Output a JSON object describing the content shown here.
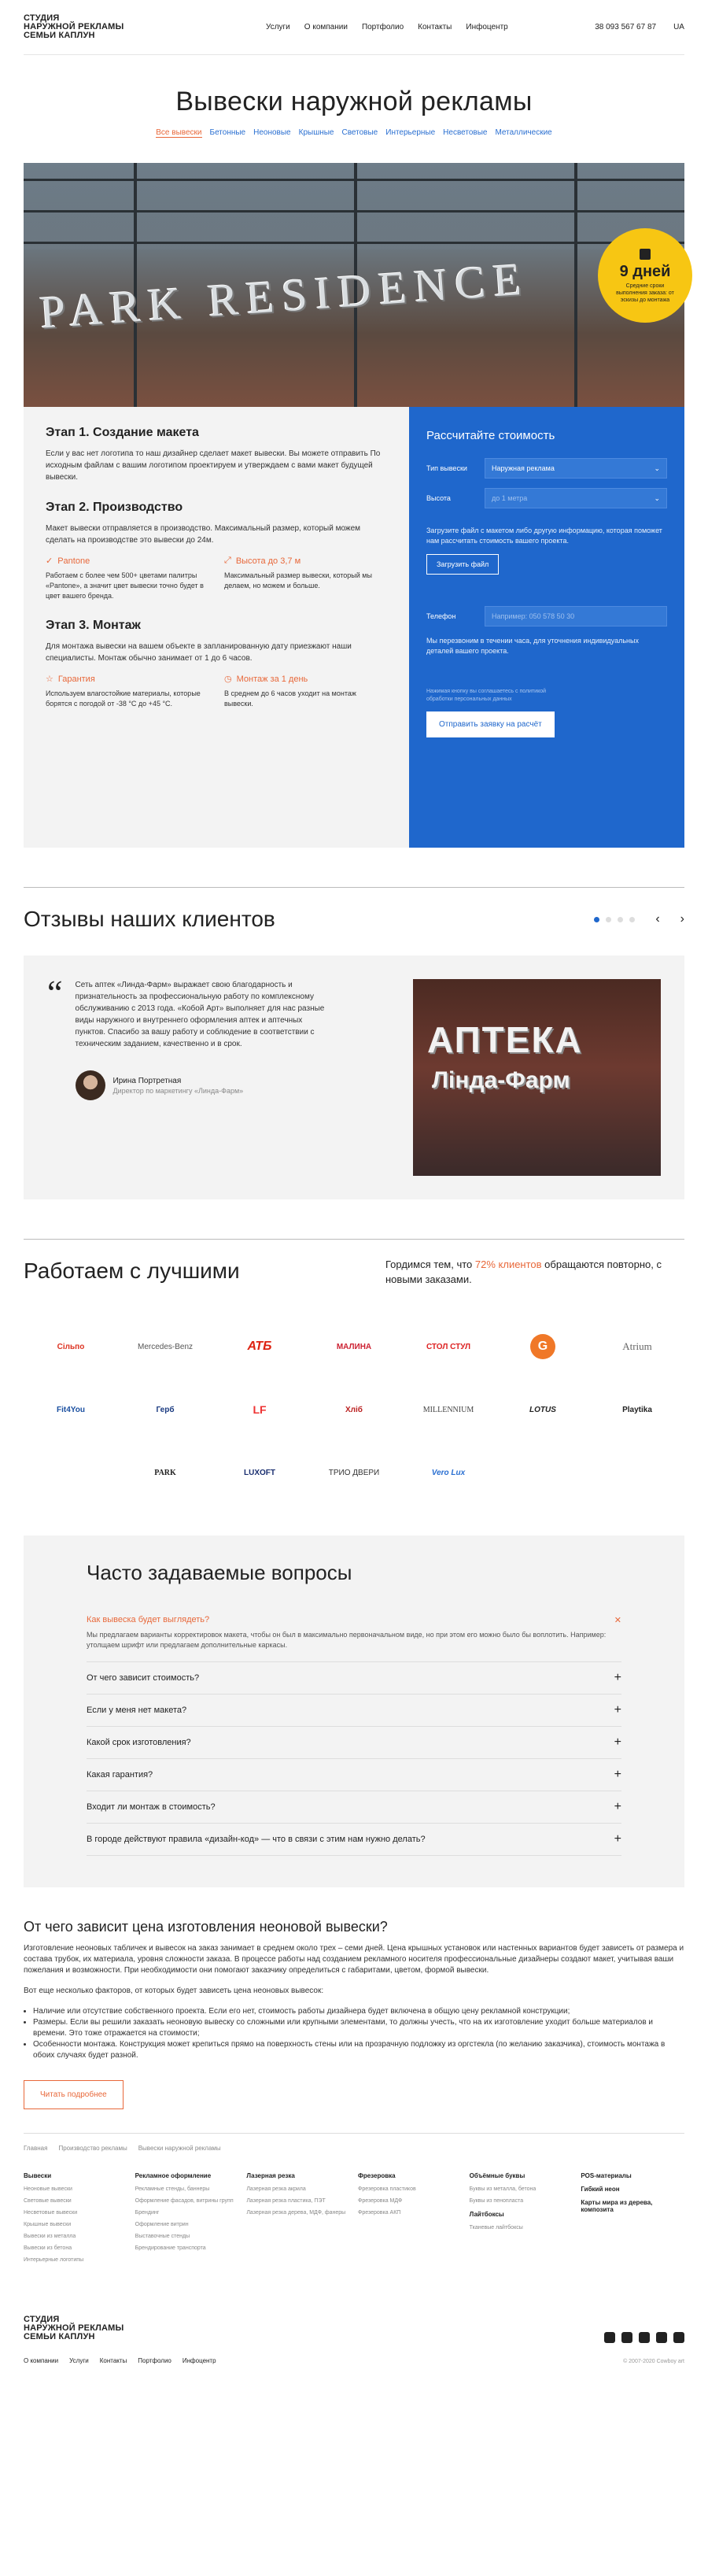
{
  "header": {
    "logo_lines": [
      "СТУДИЯ",
      "НАРУЖНОЙ РЕКЛАМЫ",
      "СЕМЬИ КАПЛУН"
    ],
    "nav": [
      "Услуги",
      "О компании",
      "Портфолио",
      "Контакты",
      "Инфоцентр"
    ],
    "phone": "38 093 567 67 87",
    "lang": "UA"
  },
  "page": {
    "title": "Вывески наружной рекламы",
    "tabs": [
      "Все вывески",
      "Бетонные",
      "Неоновые",
      "Крышные",
      "Световые",
      "Интерьерные",
      "Несветовые",
      "Металлические"
    ]
  },
  "hero": {
    "sign_text": "PARK RESIDENCE",
    "badge": {
      "days": "9 дней",
      "text": "Средние сроки выполнения заказа: от эскизы до монтажа"
    }
  },
  "stages": [
    {
      "title": "Этап 1. Создание макета",
      "text": "Если у вас нет логотипа то наш дизайнер сделает макет вывески. Вы можете отправить По исходным файлам с вашим логотипом проектируем и утверждаем с вами макет будущей вывески."
    },
    {
      "title": "Этап 2. Производство",
      "text": "Макет вывески отправляется в производство. Максимальный размер, который можем сделать на производстве это вывески до 24м.",
      "features": [
        {
          "title": "Pantone",
          "text": "Работаем с более чем 500+ цветами палитры «Pantone», а значит цвет вывески точно будет в цвет вашего бренда."
        },
        {
          "title": "Высота до 3,7 м",
          "text": "Максимальный размер вывески, который мы делаем, но можем и больше."
        }
      ]
    },
    {
      "title": "Этап 3. Монтаж",
      "text": "Для монтажа вывески на вашем объекте в запланированную дату приезжают наши специалисты. Монтаж обычно занимает от 1 до 6 часов.",
      "features": [
        {
          "title": "Гарантия",
          "text": "Используем влагостойкие материалы, которые борятся с погодой от -38 °С до +45 °С."
        },
        {
          "title": "Монтаж за 1 день",
          "text": "В среднем до 6 часов уходит на монтаж вывески."
        }
      ]
    }
  ],
  "calc": {
    "title": "Рассчитайте стоимость",
    "type_label": "Тип вывески",
    "type_value": "Наружная реклама",
    "height_label": "Высота",
    "height_ph": "до 1 метра",
    "upload_text": "Загрузите файл с макетом либо другую информацию, которая поможет нам рассчитать стоимость вашего проекта.",
    "upload_btn": "Загрузить файл",
    "phone_label": "Телефон",
    "phone_ph": "Например: 050 578 50 30",
    "callback_text": "Мы перезвоним в течении часа, для уточнения индивидуальных деталей вашего проекта.",
    "consent": "Нажимая кнопку вы соглашаетесь с политикой обработки персональных данных",
    "submit": "Отправить заявку на расчёт"
  },
  "reviews": {
    "title": "Отзывы наших клиентов",
    "text": "Сеть аптек «Линда-Фарм» выражает свою благодарность и признательность за профессиональную работу по комплексному обслуживанию с 2013 года. «Кобой Арт» выполняет для нас разные виды наружного и внутреннего оформления аптек и аптечных пунктов. Спасибо за вашу работу и соблюдение в соответствии с техническим заданием, качественно и в срок.",
    "author": "Ирина Портретная",
    "role": "Директор по маркетингу «Линда-Фарм»",
    "photo_l1": "АПТЕКА",
    "photo_l2": "Лінда-Фарм"
  },
  "partners": {
    "title": "Работаем с лучшими",
    "text_a": "Гордимся тем, что ",
    "highlight": "72% клиентов",
    "text_b": " обращаются повторно, с новыми заказами.",
    "logos": [
      "Сільпо",
      "Mercedes-Benz",
      "АТБ",
      "МАЛИНА",
      "СТОЛ СТУЛ",
      "G",
      "Atrium",
      "Fit4You",
      "Герб",
      "LF",
      "Хліб",
      "MILLENNIUM",
      "LOTUS",
      "Playtika",
      "PARK",
      "LUXOFT",
      "ТРИО ДВЕРИ",
      "Vero Lux"
    ]
  },
  "faq": {
    "title": "Часто задаваемые вопросы",
    "items": [
      {
        "q": "Как вывеска будет выглядеть?",
        "a": "Мы предлагаем варианты корректировок макета, чтобы он был в максимально первоначальном виде, но при этом его можно было бы воплотить. Например: утолщаем шрифт или предлагаем дополнительные каркасы."
      },
      {
        "q": "От чего зависит стоимость?"
      },
      {
        "q": "Если у меня нет макета?"
      },
      {
        "q": "Какой срок изготовления?"
      },
      {
        "q": "Какая гарантия?"
      },
      {
        "q": "Входит ли монтаж в стоимость?"
      },
      {
        "q": "В городе действуют правила «дизайн-код» — что в связи с этим нам нужно делать?"
      }
    ]
  },
  "article": {
    "title": "От чего зависит цена изготовления неоновой вывески?",
    "p1": "Изготовление неоновых табличек и вывесок на заказ занимает в среднем около трех – семи дней. Цена крышных установок или настенных вариантов будет зависеть от размера и состава трубок, их материала, уровня сложности заказа. В процессе работы над созданием рекламного носителя профессиональные дизайнеры создают макет, учитывая ваши пожелания и возможности. При необходимости они помогают заказчику определиться с габаритами, цветом, формой вывески.",
    "p2": "Вот еще несколько факторов, от которых будет зависеть цена неоновых вывесок:",
    "list": [
      "Наличие или отсутствие собственного проекта. Если его нет, стоимость работы дизайнера будет включена в общую цену рекламной конструкции;",
      "Размеры. Если вы решили заказать неоновую вывеску со сложными или крупными элементами, то должны учесть, что на их изготовление уходит больше материалов и времени. Это тоже отражается на стоимости;",
      "Особенности монтажа. Конструкция может крепиться прямо на поверхность стены или на прозрачную подложку из оргстекла (по желанию заказчика), стоимость монтажа в обоих случаях будет разной."
    ],
    "more": "Читать подробнее"
  },
  "footer": {
    "breadcrumbs": [
      "Главная",
      "Производство рекламы",
      "Вывески наружной рекламы"
    ],
    "cols": [
      {
        "h": "Вывески",
        "items": [
          "Неоновые вывески",
          "Световые вывески",
          "Несветовые вывески",
          "Крышные вывески",
          "Вывески из металла",
          "Вывески из бетона",
          "Интерьерные логотипы"
        ]
      },
      {
        "h": "Рекламное оформление",
        "items": [
          "Рекламные стенды, баннеры",
          "Оформление фасадов, витрины групп",
          "Брендинг",
          "Оформление витрин",
          "Выставочные стенды",
          "Брендирование транспорта"
        ]
      },
      {
        "h": "Лазерная резка",
        "items": [
          "Лазерная резка акрила",
          "Лазерная резка пластика, ПЭТ",
          "Лазерная резка дерева, МДФ, фанеры"
        ]
      },
      {
        "h": "Фрезеровка",
        "items": [
          "Фрезеровка пластиков",
          "Фрезеровка МДФ",
          "Фрезеровка АКП"
        ]
      },
      {
        "h": "Объёмные буквы",
        "items": [
          "Буквы из металла, бетона",
          "Буквы из пенопласта",
          "Лайтбоксы",
          "Тканевые лайтбоксы"
        ]
      },
      {
        "h": "POS-материалы",
        "items": [
          "Гибкий неон",
          "Карты мира из дерева, композита"
        ]
      }
    ],
    "nav": [
      "О компании",
      "Услуги",
      "Контакты",
      "Портфолио",
      "Инфоцентр"
    ],
    "copy": "© 2007-2020 Cowboy art"
  }
}
